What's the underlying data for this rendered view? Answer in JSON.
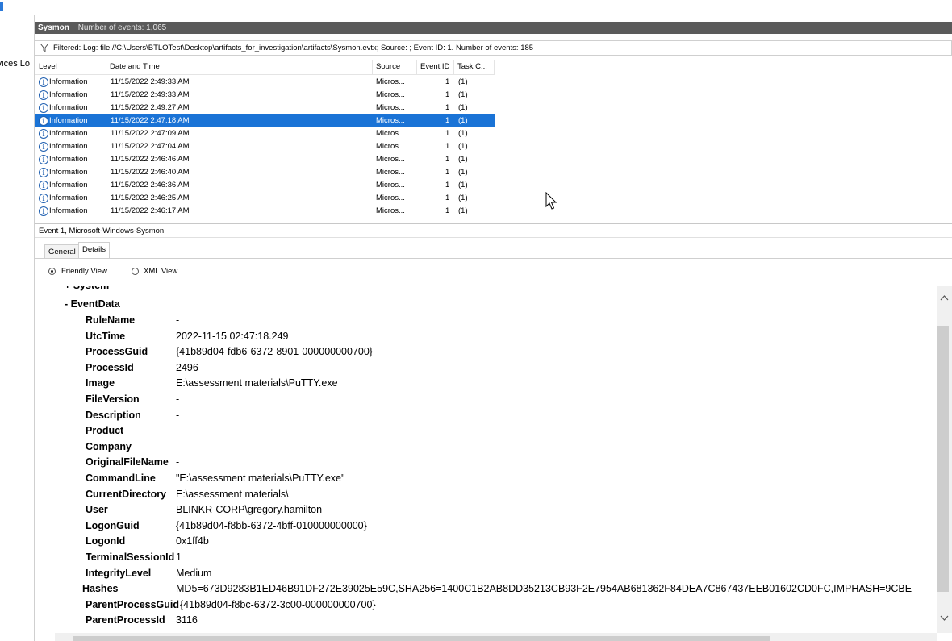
{
  "leftnav": {
    "partial_label": "Services Lo"
  },
  "header": {
    "log_name": "Sysmon",
    "count_text": "Number of events: 1,065"
  },
  "filter": {
    "text": "Filtered: Log: file://C:\\Users\\BTLOTest\\Desktop\\artifacts_for_investigation\\artifacts\\Sysmon.evtx; Source: ; Event ID: 1. Number of events: 185"
  },
  "table": {
    "columns": [
      "Level",
      "Date and Time",
      "Source",
      "Event ID",
      "Task C..."
    ],
    "rows": [
      {
        "level": "Information",
        "datetime": "11/15/2022 2:49:33 AM",
        "source": "Micros...",
        "event_id": "1",
        "task": "(1)"
      },
      {
        "level": "Information",
        "datetime": "11/15/2022 2:49:33 AM",
        "source": "Micros...",
        "event_id": "1",
        "task": "(1)"
      },
      {
        "level": "Information",
        "datetime": "11/15/2022 2:49:27 AM",
        "source": "Micros...",
        "event_id": "1",
        "task": "(1)"
      },
      {
        "level": "Information",
        "datetime": "11/15/2022 2:47:18 AM",
        "source": "Micros...",
        "event_id": "1",
        "task": "(1)"
      },
      {
        "level": "Information",
        "datetime": "11/15/2022 2:47:09 AM",
        "source": "Micros...",
        "event_id": "1",
        "task": "(1)"
      },
      {
        "level": "Information",
        "datetime": "11/15/2022 2:47:04 AM",
        "source": "Micros...",
        "event_id": "1",
        "task": "(1)"
      },
      {
        "level": "Information",
        "datetime": "11/15/2022 2:46:46 AM",
        "source": "Micros...",
        "event_id": "1",
        "task": "(1)"
      },
      {
        "level": "Information",
        "datetime": "11/15/2022 2:46:40 AM",
        "source": "Micros...",
        "event_id": "1",
        "task": "(1)"
      },
      {
        "level": "Information",
        "datetime": "11/15/2022 2:46:36 AM",
        "source": "Micros...",
        "event_id": "1",
        "task": "(1)"
      },
      {
        "level": "Information",
        "datetime": "11/15/2022 2:46:25 AM",
        "source": "Micros...",
        "event_id": "1",
        "task": "(1)"
      },
      {
        "level": "Information",
        "datetime": "11/15/2022 2:46:17 AM",
        "source": "Micros...",
        "event_id": "1",
        "task": "(1)"
      }
    ],
    "selected_row": 3
  },
  "event_title": "Event 1, Microsoft-Windows-Sysmon",
  "tabs": {
    "general": "General",
    "details": "Details"
  },
  "views": {
    "friendly": "Friendly View",
    "xml": "XML View"
  },
  "details": {
    "system_label": "+ System",
    "eventdata_label": "- EventData",
    "fields": [
      {
        "key": "RuleName",
        "value": "-"
      },
      {
        "key": "UtcTime",
        "value": "2022-11-15 02:47:18.249"
      },
      {
        "key": "ProcessGuid",
        "value": "{41b89d04-fdb6-6372-8901-000000000700}"
      },
      {
        "key": "ProcessId",
        "value": "2496"
      },
      {
        "key": "Image",
        "value": "E:\\assessment materials\\PuTTY.exe"
      },
      {
        "key": "FileVersion",
        "value": "-"
      },
      {
        "key": "Description",
        "value": "-"
      },
      {
        "key": "Product",
        "value": "-"
      },
      {
        "key": "Company",
        "value": "-"
      },
      {
        "key": "OriginalFileName",
        "value": "-"
      },
      {
        "key": "CommandLine",
        "value": "\"E:\\assessment materials\\PuTTY.exe\""
      },
      {
        "key": "CurrentDirectory",
        "value": "E:\\assessment materials\\"
      },
      {
        "key": "User",
        "value": "BLINKR-CORP\\gregory.hamilton"
      },
      {
        "key": "LogonGuid",
        "value": "{41b89d04-f8bb-6372-4bff-010000000000}"
      },
      {
        "key": "LogonId",
        "value": "0x1ff4b"
      },
      {
        "key": "TerminalSessionId",
        "value": "1"
      },
      {
        "key": "IntegrityLevel",
        "value": "Medium"
      },
      {
        "key": "Hashes",
        "value": "MD5=673D9283B1ED46B91DF272E39025E59C,SHA256=1400C1B2AB8DD35213CB93F2E7954AB681362F84DEA7C867437EEB01602CD0FC,IMPHASH=9CBE"
      },
      {
        "key": "ParentProcessGuid",
        "value": "{41b89d04-f8bc-6372-3c00-000000000700}"
      },
      {
        "key": "ParentProcessId",
        "value": "3116"
      }
    ]
  },
  "colors": {
    "selection": "#1a73d6",
    "header_bg": "#5a5a5a"
  },
  "icons": [
    "filter-icon",
    "information-icon",
    "mouse-pointer-icon",
    "scroll-up-icon",
    "scroll-down-icon"
  ]
}
